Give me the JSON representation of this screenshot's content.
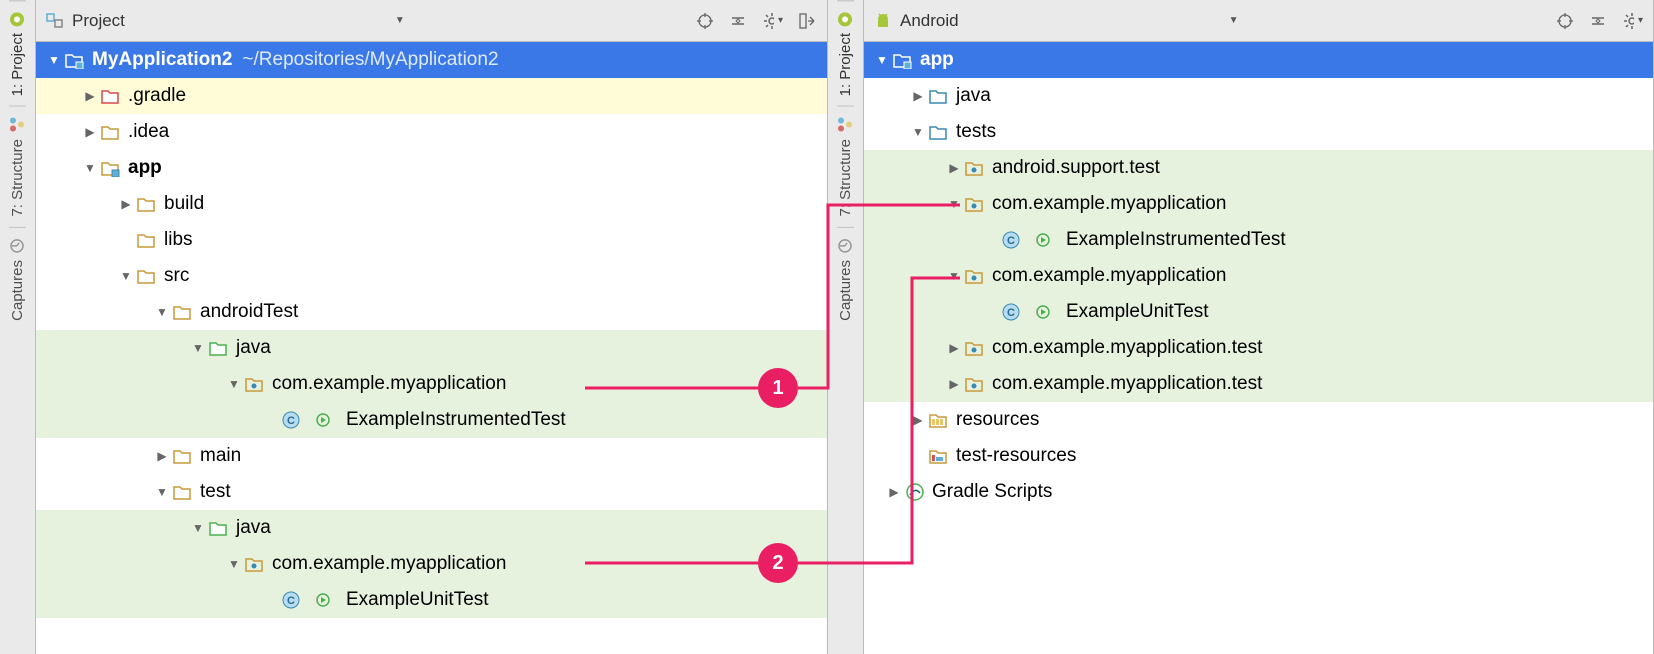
{
  "left": {
    "header": {
      "title": "Project"
    },
    "sidebar": {
      "tabs": [
        {
          "label": "1: Project",
          "icon": "project-tab-icon"
        },
        {
          "label": "7: Structure",
          "icon": "structure-tab-icon"
        },
        {
          "label": "Captures",
          "icon": "captures-tab-icon"
        }
      ]
    },
    "tree": {
      "root": {
        "name": "MyApplication2",
        "path": "~/Repositories/MyApplication2"
      },
      "items": [
        {
          "name": ".gradle"
        },
        {
          "name": ".idea"
        },
        {
          "name": "app"
        },
        {
          "name": "build"
        },
        {
          "name": "libs"
        },
        {
          "name": "src"
        },
        {
          "name": "androidTest"
        },
        {
          "name": "java"
        },
        {
          "name": "com.example.myapplication"
        },
        {
          "name": "ExampleInstrumentedTest"
        },
        {
          "name": "main"
        },
        {
          "name": "test"
        },
        {
          "name": "java"
        },
        {
          "name": "com.example.myapplication"
        },
        {
          "name": "ExampleUnitTest"
        }
      ]
    }
  },
  "right": {
    "header": {
      "title": "Android"
    },
    "sidebar": {
      "tabs": [
        {
          "label": "1: Project",
          "icon": "project-tab-icon"
        },
        {
          "label": "7: Structure",
          "icon": "structure-tab-icon"
        },
        {
          "label": "Captures",
          "icon": "captures-tab-icon"
        }
      ]
    },
    "tree": {
      "root": {
        "name": "app"
      },
      "items": [
        {
          "name": "java"
        },
        {
          "name": "tests"
        },
        {
          "name": "android.support.test"
        },
        {
          "name": "com.example.myapplication"
        },
        {
          "name": "ExampleInstrumentedTest"
        },
        {
          "name": "com.example.myapplication"
        },
        {
          "name": "ExampleUnitTest"
        },
        {
          "name": "com.example.myapplication.test"
        },
        {
          "name": "com.example.myapplication.test"
        },
        {
          "name": "resources"
        },
        {
          "name": "test-resources"
        },
        {
          "name": "Gradle Scripts"
        }
      ]
    }
  },
  "callouts": {
    "one": "1",
    "two": "2"
  }
}
